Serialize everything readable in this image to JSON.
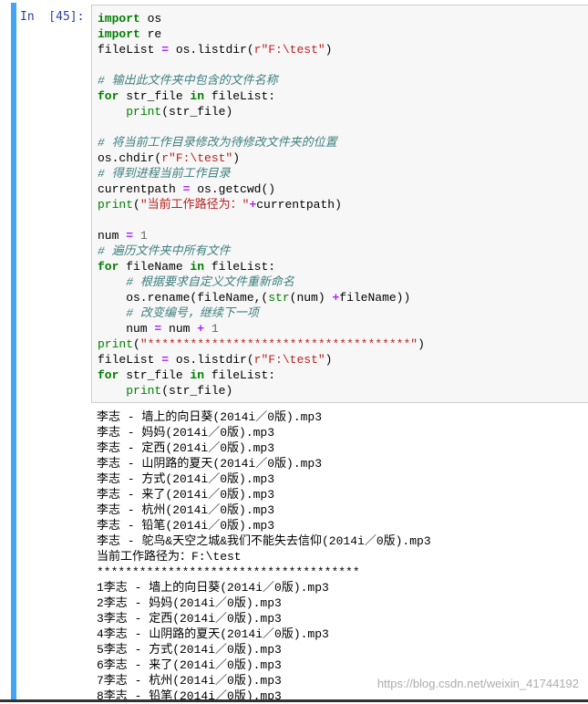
{
  "cell": {
    "prompt": "In  [45]:",
    "code_lines": [
      [
        {
          "t": "import",
          "c": "kw"
        },
        {
          "t": " os",
          "c": ""
        }
      ],
      [
        {
          "t": "import",
          "c": "kw"
        },
        {
          "t": " re",
          "c": ""
        }
      ],
      [
        {
          "t": "fileList ",
          "c": ""
        },
        {
          "t": "=",
          "c": "op"
        },
        {
          "t": " os.listdir(",
          "c": ""
        },
        {
          "t": "r\"F:\\test\"",
          "c": "str"
        },
        {
          "t": ")",
          "c": ""
        }
      ],
      [],
      [
        {
          "t": "# 输出此文件夹中包含的文件名称",
          "c": "com"
        }
      ],
      [
        {
          "t": "for",
          "c": "kw"
        },
        {
          "t": " str_file ",
          "c": ""
        },
        {
          "t": "in",
          "c": "kw"
        },
        {
          "t": " fileList:",
          "c": ""
        }
      ],
      [
        {
          "t": "    ",
          "c": ""
        },
        {
          "t": "print",
          "c": "bi"
        },
        {
          "t": "(str_file)",
          "c": ""
        }
      ],
      [],
      [
        {
          "t": "# 将当前工作目录修改为待修改文件夹的位置",
          "c": "com"
        }
      ],
      [
        {
          "t": "os.chdir(",
          "c": ""
        },
        {
          "t": "r\"F:\\test\"",
          "c": "str"
        },
        {
          "t": ")",
          "c": ""
        }
      ],
      [
        {
          "t": "# 得到进程当前工作目录",
          "c": "com"
        }
      ],
      [
        {
          "t": "currentpath ",
          "c": ""
        },
        {
          "t": "=",
          "c": "op"
        },
        {
          "t": " os.getcwd()",
          "c": ""
        }
      ],
      [
        {
          "t": "print",
          "c": "bi"
        },
        {
          "t": "(",
          "c": ""
        },
        {
          "t": "\"当前工作路径为：\"",
          "c": "str"
        },
        {
          "t": "+",
          "c": "op"
        },
        {
          "t": "currentpath)",
          "c": ""
        }
      ],
      [],
      [
        {
          "t": "num ",
          "c": ""
        },
        {
          "t": "=",
          "c": "op"
        },
        {
          "t": " ",
          "c": ""
        },
        {
          "t": "1",
          "c": "num"
        }
      ],
      [
        {
          "t": "# 遍历文件夹中所有文件",
          "c": "com"
        }
      ],
      [
        {
          "t": "for",
          "c": "kw"
        },
        {
          "t": " fileName ",
          "c": ""
        },
        {
          "t": "in",
          "c": "kw"
        },
        {
          "t": " fileList:",
          "c": ""
        }
      ],
      [
        {
          "t": "    ",
          "c": ""
        },
        {
          "t": "# 根据要求自定义文件重新命名",
          "c": "com"
        }
      ],
      [
        {
          "t": "    os.rename(fileName,(",
          "c": ""
        },
        {
          "t": "str",
          "c": "bi"
        },
        {
          "t": "(num) ",
          "c": ""
        },
        {
          "t": "+",
          "c": "op"
        },
        {
          "t": "fileName))",
          "c": ""
        }
      ],
      [
        {
          "t": "    ",
          "c": ""
        },
        {
          "t": "# 改变编号，继续下一项",
          "c": "com"
        }
      ],
      [
        {
          "t": "    num ",
          "c": ""
        },
        {
          "t": "=",
          "c": "op"
        },
        {
          "t": " num ",
          "c": ""
        },
        {
          "t": "+",
          "c": "op"
        },
        {
          "t": " ",
          "c": ""
        },
        {
          "t": "1",
          "c": "num"
        }
      ],
      [
        {
          "t": "print",
          "c": "bi"
        },
        {
          "t": "(",
          "c": ""
        },
        {
          "t": "\"*************************************\"",
          "c": "str"
        },
        {
          "t": ")",
          "c": ""
        }
      ],
      [
        {
          "t": "fileList ",
          "c": ""
        },
        {
          "t": "=",
          "c": "op"
        },
        {
          "t": " os.listdir(",
          "c": ""
        },
        {
          "t": "r\"F:\\test\"",
          "c": "str"
        },
        {
          "t": ")",
          "c": ""
        }
      ],
      [
        {
          "t": "for",
          "c": "kw"
        },
        {
          "t": " str_file ",
          "c": ""
        },
        {
          "t": "in",
          "c": "kw"
        },
        {
          "t": " fileList:",
          "c": ""
        }
      ],
      [
        {
          "t": "    ",
          "c": ""
        },
        {
          "t": "print",
          "c": "bi"
        },
        {
          "t": "(str_file)",
          "c": ""
        }
      ]
    ],
    "output_lines": [
      "李志 - 墙上的向日葵(2014i／0版).mp3",
      "李志 - 妈妈(2014i／0版).mp3",
      "李志 - 定西(2014i／0版).mp3",
      "李志 - 山阴路的夏天(2014i／0版).mp3",
      "李志 - 方式(2014i／0版).mp3",
      "李志 - 来了(2014i／0版).mp3",
      "李志 - 杭州(2014i／0版).mp3",
      "李志 - 铅笔(2014i／0版).mp3",
      "李志 - 鸵鸟&天空之城&我们不能失去信仰(2014i／0版).mp3",
      "当前工作路径为：F:\\test",
      "*************************************",
      "1李志 - 墙上的向日葵(2014i／0版).mp3",
      "2李志 - 妈妈(2014i／0版).mp3",
      "3李志 - 定西(2014i／0版).mp3",
      "4李志 - 山阴路的夏天(2014i／0版).mp3",
      "5李志 - 方式(2014i／0版).mp3",
      "6李志 - 来了(2014i／0版).mp3",
      "7李志 - 杭州(2014i／0版).mp3",
      "8李志 - 铅笔(2014i／0版).mp3"
    ]
  },
  "watermark": "https://blog.csdn.net/weixin_41744192",
  "colors": {
    "keyword": "#008000",
    "comment": "#408080",
    "string": "#ba2121",
    "operator": "#aa22ff",
    "number": "#666666",
    "prompt": "#303f9f",
    "selected_bar": "#42a5f5"
  }
}
